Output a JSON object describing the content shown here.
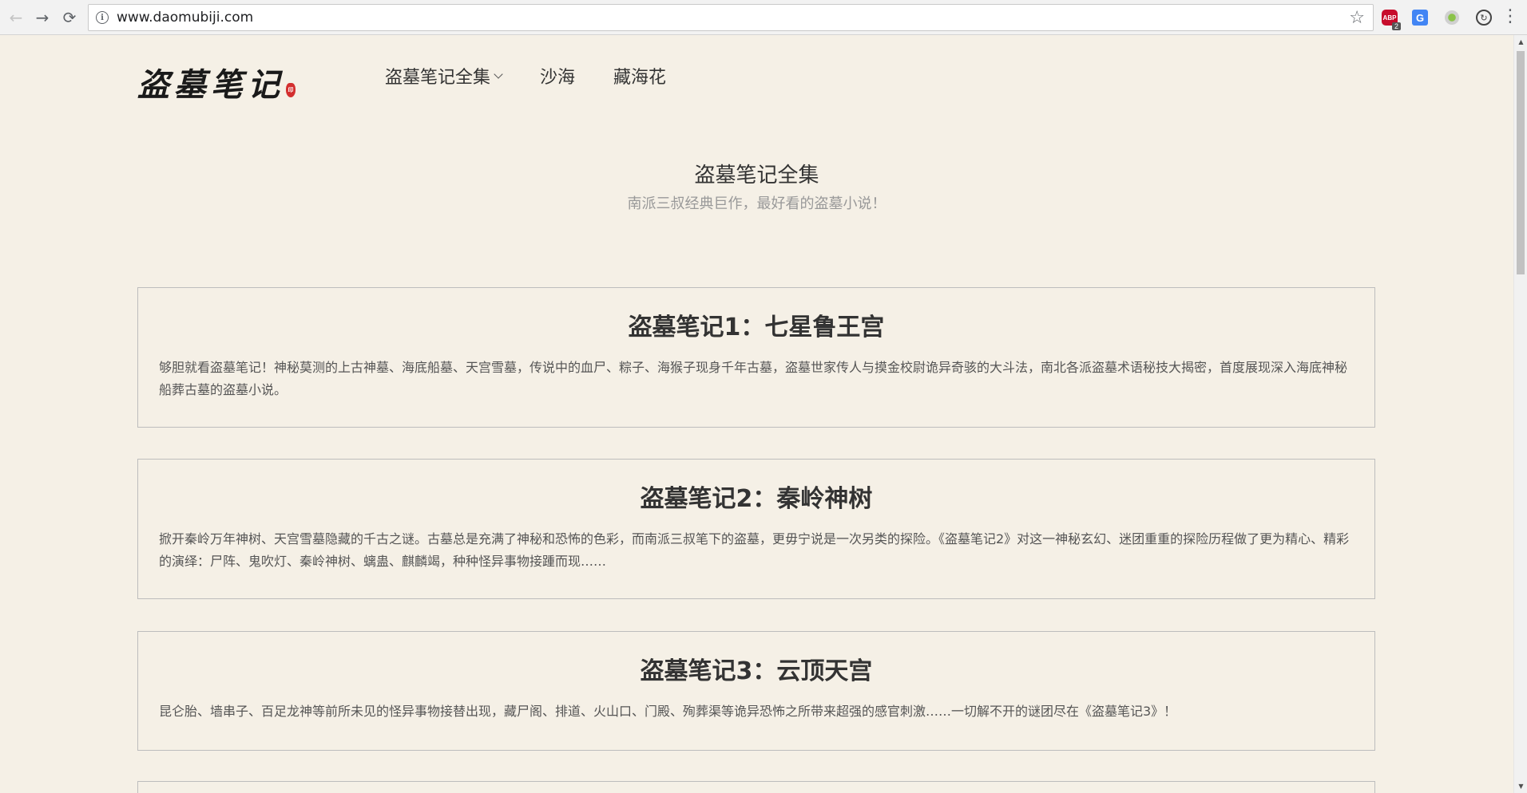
{
  "browser": {
    "url": "www.daomubiji.com",
    "back_glyph": "←",
    "forward_glyph": "→",
    "reload_glyph": "⟳",
    "info_glyph": "i",
    "star_glyph": "☆",
    "menu_glyph": "⋮",
    "extensions": {
      "adblock_label": "ABP",
      "adblock_badge": "2",
      "translate_label": "G",
      "sync_glyph": "↻"
    }
  },
  "site": {
    "logo_text": "盗墓笔记",
    "logo_seal": "印",
    "nav": [
      {
        "label": "盗墓笔记全集"
      },
      {
        "label": "沙海"
      },
      {
        "label": "藏海花"
      }
    ],
    "hero": {
      "title": "盗墓笔记全集",
      "subtitle": "南派三叔经典巨作，最好看的盗墓小说！"
    },
    "books": [
      {
        "title": "盗墓笔记1：七星鲁王宫",
        "desc": "够胆就看盗墓笔记！神秘莫测的上古神墓、海底船墓、天宫雪墓，传说中的血尸、粽子、海猴子现身千年古墓，盗墓世家传人与摸金校尉诡异奇骇的大斗法，南北各派盗墓术语秘技大揭密，首度展现深入海底神秘船葬古墓的盗墓小说。"
      },
      {
        "title": "盗墓笔记2：秦岭神树",
        "desc": "掀开秦岭万年神树、天宫雪墓隐藏的千古之谜。古墓总是充满了神秘和恐怖的色彩，而南派三叔笔下的盗墓，更毋宁说是一次另类的探险。《盗墓笔记2》对这一神秘玄幻、迷团重重的探险历程做了更为精心、精彩的演绎：尸阵、鬼吹灯、秦岭神树、螭蛊、麒麟竭，种种怪异事物接踵而现……"
      },
      {
        "title": "盗墓笔记3：云顶天宫",
        "desc": "昆仑胎、墙串子、百足龙神等前所未见的怪异事物接替出现，藏尸阁、排道、火山口、门殿、殉葬渠等诡异恐怖之所带来超强的感官刺激……一切解不开的谜团尽在《盗墓笔记3》！"
      }
    ]
  }
}
